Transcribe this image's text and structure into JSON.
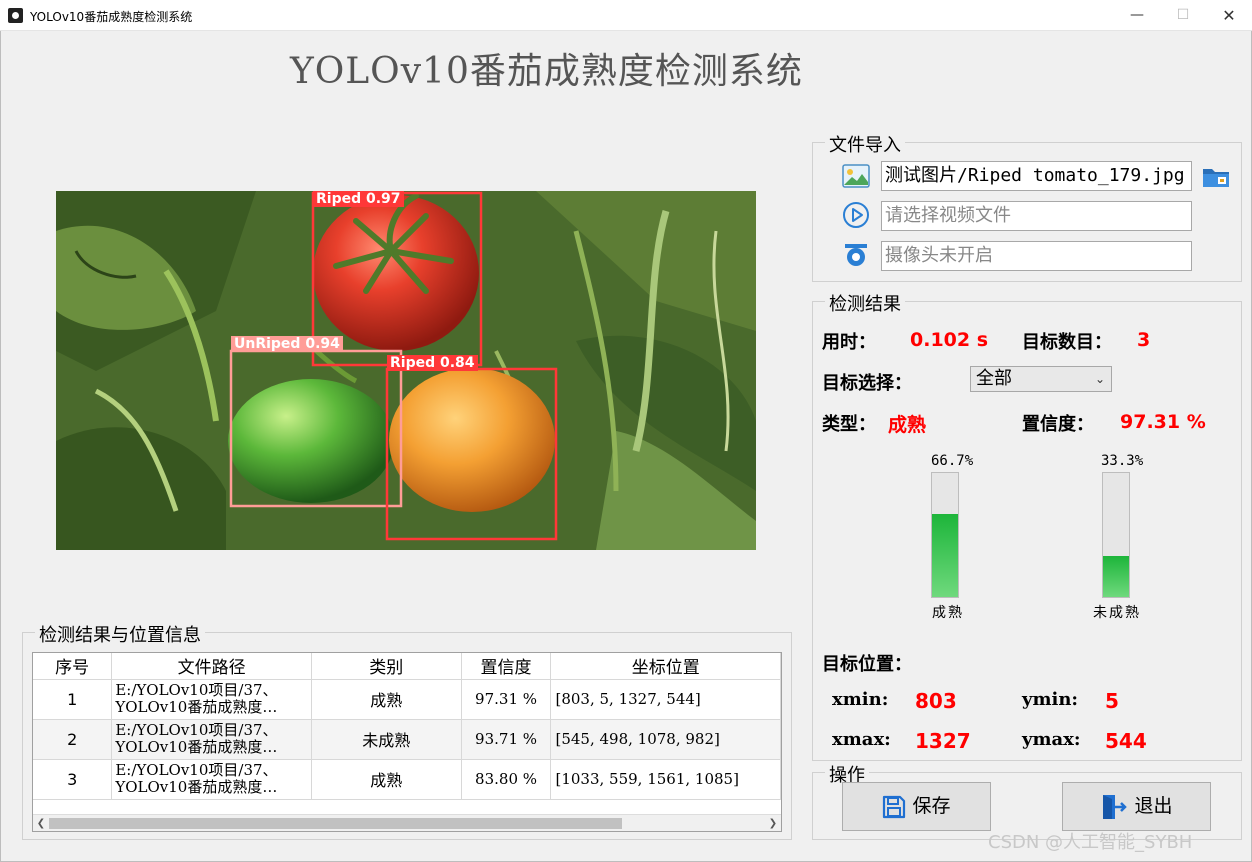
{
  "window": {
    "title": "YOLOv10番茄成熟度检测系统",
    "minimize": "—",
    "maximize": "☐",
    "close": "✕"
  },
  "main_title": "YOLOv10番茄成熟度检测系统",
  "detections_overlay": [
    {
      "label": "Riped  0.97",
      "color": "#ff3838"
    },
    {
      "label": "UnRiped  0.94",
      "color": "#ff9d97"
    },
    {
      "label": "Riped  0.84",
      "color": "#ff3838"
    }
  ],
  "file_import": {
    "title": "文件导入",
    "image_path": "测试图片/Riped tomato_179.jpg",
    "video_placeholder": "请选择视频文件",
    "camera_placeholder": "摄像头未开启",
    "icons": [
      "image-icon",
      "video-play-icon",
      "camera-icon",
      "folder-icon"
    ]
  },
  "result": {
    "title": "检测结果",
    "time_label": "用时：",
    "time_value": "0.102 s",
    "count_label": "目标数目：",
    "count_value": "3",
    "select_label": "目标选择：",
    "select_value": "全部",
    "type_label": "类型：",
    "type_value": "成熟",
    "conf_label": "置信度：",
    "conf_value": "97.31 %",
    "bars": [
      {
        "pct_text": "66.7%",
        "name": "成熟",
        "fraction": 0.667
      },
      {
        "pct_text": "33.3%",
        "name": "未成熟",
        "fraction": 0.333
      }
    ],
    "position_label": "目标位置：",
    "xmin_label": "xmin:",
    "xmin": "803",
    "ymin_label": "ymin:",
    "ymin": "5",
    "xmax_label": "xmax:",
    "xmax": "1327",
    "ymax_label": "ymax:",
    "ymax": "544"
  },
  "operations": {
    "title": "操作",
    "save": "保存",
    "exit": "退出"
  },
  "table": {
    "title": "检测结果与位置信息",
    "headers": [
      "序号",
      "文件路径",
      "类别",
      "置信度",
      "坐标位置"
    ],
    "rows": [
      {
        "idx": "1",
        "path1": "E:/YOLOv10项目/37、",
        "path2": "YOLOv10番茄成熟度…",
        "cls": "成熟",
        "conf": "97.31 %",
        "coord": "[803, 5, 1327, 544]"
      },
      {
        "idx": "2",
        "path1": "E:/YOLOv10项目/37、",
        "path2": "YOLOv10番茄成熟度…",
        "cls": "未成熟",
        "conf": "93.71 %",
        "coord": "[545, 498, 1078, 982]"
      },
      {
        "idx": "3",
        "path1": "E:/YOLOv10项目/37、",
        "path2": "YOLOv10番茄成熟度…",
        "cls": "成熟",
        "conf": "83.80 %",
        "coord": "[1033, 559, 1561, 1085]"
      }
    ]
  },
  "watermark": "CSDN @人工智能_SYBH"
}
